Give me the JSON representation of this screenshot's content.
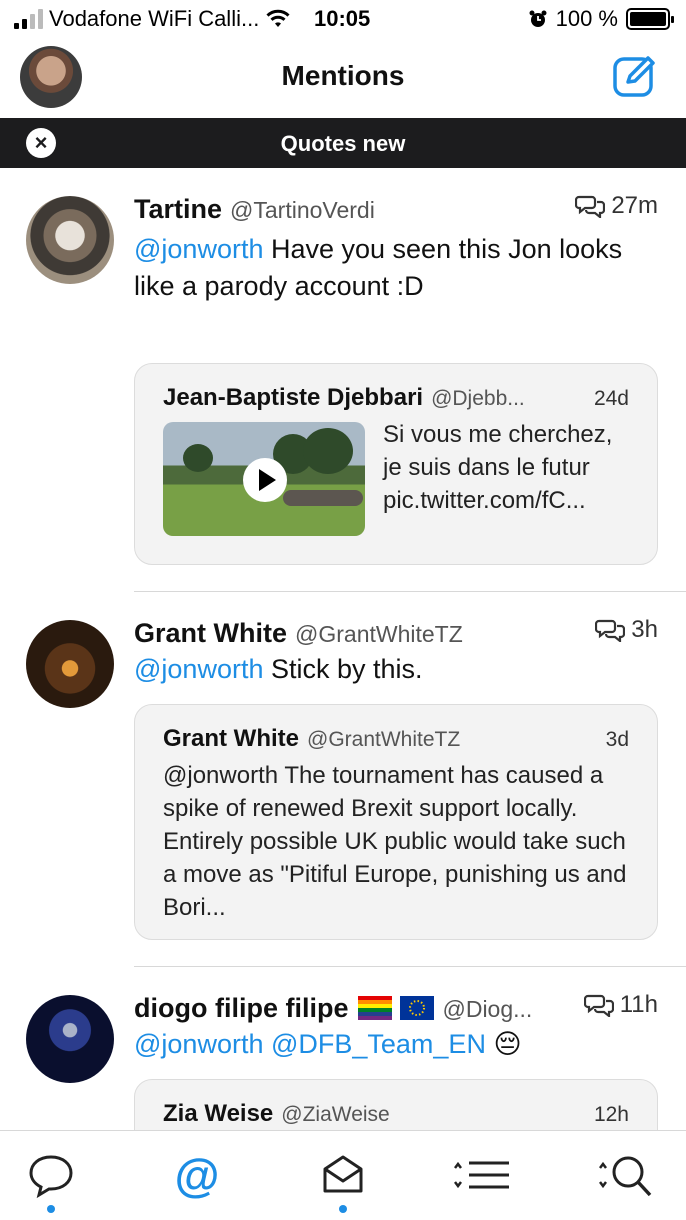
{
  "status_bar": {
    "carrier": "Vodafone WiFi Calli...",
    "time": "10:05",
    "battery": "100 %"
  },
  "header": {
    "title": "Mentions"
  },
  "banner": {
    "close_glyph": "×",
    "text": "Quotes new"
  },
  "tweets": [
    {
      "name": "Tartine",
      "handle": "@TartinoVerdi",
      "time": "27m",
      "mention": "@jonworth",
      "text": " Have you seen this Jon looks like a parody account :D",
      "quote": {
        "name": "Jean-Baptiste Djebbari",
        "handle": "@Djebb...",
        "time": "24d",
        "text": "Si vous me cherchez, je suis dans le futur pic.twitter.com/fC..."
      }
    },
    {
      "name": "Grant White",
      "handle": "@GrantWhiteTZ",
      "time": "3h",
      "mention": "@jonworth",
      "text": " Stick by this.",
      "quote": {
        "name": "Grant White",
        "handle": "@GrantWhiteTZ",
        "time": "3d",
        "text": "@jonworth The tournament has caused a spike of renewed Brexit support locally. Entirely possible UK public would take such a move as \"Pitiful Europe, punishing us and Bori..."
      }
    },
    {
      "name": "diogo filipe filipe",
      "handle": "@Diog...",
      "time": "11h",
      "mention": "@jonworth @DFB_Team_EN",
      "text": " 😔",
      "quote": {
        "name": "Zia Weise",
        "handle": "@ZiaWeise",
        "time": "12h"
      }
    }
  ],
  "tabbar": {
    "at_glyph": "@",
    "active_tab": "mentions"
  },
  "colors": {
    "accent": "#1d8de4",
    "banner_bg": "#1c1c1e"
  },
  "icons": [
    "signal-icon",
    "wifi-icon",
    "alarm-icon",
    "battery-icon",
    "compose-icon",
    "close-icon",
    "conversation-icon",
    "play-icon",
    "chat-bubble-icon",
    "at-sign-icon",
    "mail-icon",
    "list-icon",
    "search-icon"
  ]
}
